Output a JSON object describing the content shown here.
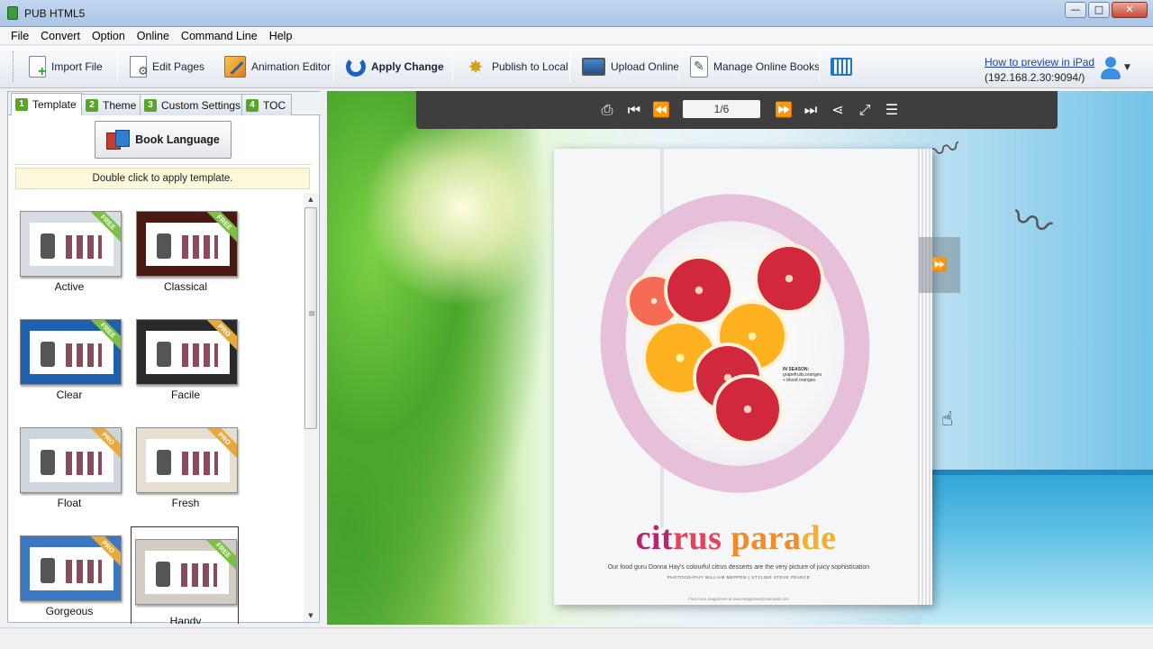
{
  "window": {
    "title": "PUB HTML5",
    "buttons": {
      "minimize": "—",
      "maximize": "□",
      "close": "✕"
    }
  },
  "menu": [
    "File",
    "Convert",
    "Option",
    "Online",
    "Command Line",
    "Help"
  ],
  "toolbar": {
    "import_file": "Import File",
    "edit_pages": "Edit Pages",
    "animation_editor": "Animation Editor",
    "apply_change": "Apply Change",
    "publish_to_local": "Publish to Local",
    "upload_online": "Upload Online",
    "manage_online_books": "Manage Online Books",
    "ipad_link": "How to preview in iPad",
    "ipad_address": "(192.168.2.30:9094/)"
  },
  "tabs": [
    {
      "num": "1",
      "label": "Template"
    },
    {
      "num": "2",
      "label": "Theme"
    },
    {
      "num": "3",
      "label": "Custom Settings"
    },
    {
      "num": "4",
      "label": "TOC"
    }
  ],
  "panel": {
    "book_language": "Book Language",
    "hint": "Double click to apply template."
  },
  "templates": [
    {
      "name": "Active",
      "badge": "FREE",
      "bg": "#d8dde3"
    },
    {
      "name": "Classical",
      "badge": "FREE",
      "bg": "#4a1a12"
    },
    {
      "name": "Clear",
      "badge": "FREE",
      "bg": "#1e5fb0"
    },
    {
      "name": "Facile",
      "badge": "PRO",
      "bg": "#2a2a2a"
    },
    {
      "name": "Float",
      "badge": "PRO",
      "bg": "#cfd5dc"
    },
    {
      "name": "Fresh",
      "badge": "PRO",
      "bg": "#e6dfcf"
    },
    {
      "name": "Gorgeous",
      "badge": "PRO",
      "bg": "#3c77c4"
    },
    {
      "name": "Handy",
      "badge": "FREE",
      "bg": "#d3ccc4",
      "selected": true
    }
  ],
  "viewer": {
    "page_indicator": "1/6",
    "icons": [
      "print-icon",
      "first-page-icon",
      "previous-page-icon",
      "next-page-icon",
      "last-page-icon",
      "share-icon",
      "fullscreen-icon",
      "thumbnails-icon"
    ]
  },
  "magazine": {
    "headline_parts": [
      "cit",
      "rus ",
      "para",
      "de"
    ],
    "subline": "Our food guru Donna Hay's colourful citrus desserts are the very picture of juicy sophistication",
    "credit": "PHOTOGRAPHY WILLIAM MEPPEM  |  STYLING STEVE PEARCE",
    "season_title": "IN SEASON:",
    "season_items": "grapefruits,oranges\n+ blood oranges",
    "footer_url": "Find more magazines at www.MagazinesDownload.com"
  },
  "colors": {
    "accent": "#1f5fbf",
    "free_badge": "#7ac143",
    "pro_badge": "#e8a93b",
    "tab_number": "#59a52c"
  }
}
